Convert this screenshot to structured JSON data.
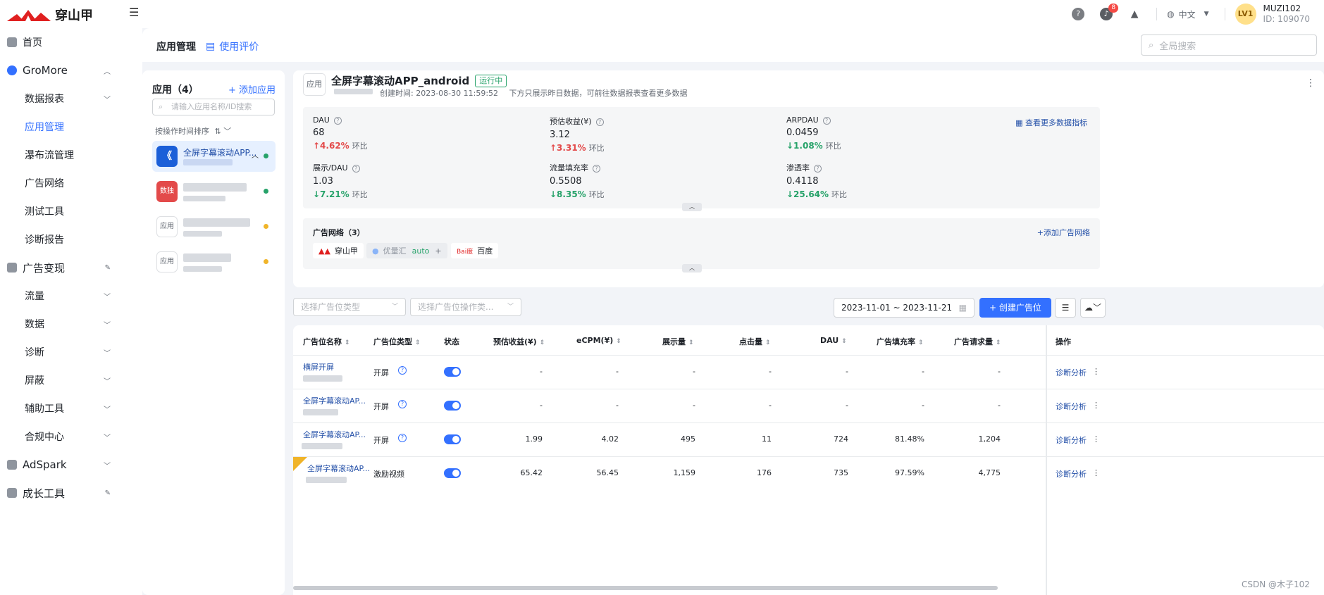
{
  "brand": {
    "name": "穿山甲",
    "accent": "#3370ff"
  },
  "topbar": {
    "notification_count": "8",
    "language": "中文",
    "level": "LV1",
    "username": "MUZI102",
    "user_id": "ID: 109070"
  },
  "sidebar": {
    "items": [
      {
        "label": "首页",
        "icon": "home-icon"
      },
      {
        "label": "GroMore",
        "icon": "gromore-icon"
      },
      {
        "label": "数据报表"
      },
      {
        "label": "应用管理"
      },
      {
        "label": "瀑布流管理"
      },
      {
        "label": "广告网络"
      },
      {
        "label": "测试工具"
      },
      {
        "label": "诊断报告"
      },
      {
        "label": "广告变现",
        "icon": "monetize-icon"
      },
      {
        "label": "流量"
      },
      {
        "label": "数据"
      },
      {
        "label": "诊断"
      },
      {
        "label": "屏蔽"
      },
      {
        "label": "辅助工具"
      },
      {
        "label": "合规中心"
      },
      {
        "label": "AdSpark",
        "icon": "adspark-icon"
      },
      {
        "label": "成长工具",
        "icon": "growth-icon"
      }
    ]
  },
  "tabs": {
    "app_manage": "应用管理",
    "usage_review": "使用评价"
  },
  "search": {
    "placeholder": "全局搜索"
  },
  "applist": {
    "title": "应用（4）",
    "add_label": "添加应用",
    "search_placeholder": "请输入应用名称/ID搜索",
    "sort_label": "按操作时间排序",
    "apps": [
      {
        "name": "全屏字幕滚动APP...",
        "icon_text": "《",
        "status_color": "#26a269"
      },
      {
        "name": "",
        "icon_text": "数独",
        "status_color": "#26a269"
      },
      {
        "name": "",
        "icon_text": "应用",
        "status_color": "#f0b429"
      },
      {
        "name": "",
        "icon_text": "应用",
        "status_color": "#f0b429"
      }
    ]
  },
  "detail": {
    "icon_text": "应用",
    "title": "全屏字幕滚动APP_android",
    "status": "运行中",
    "created": "创建时间: 2023-08-30 11:59:52",
    "note": "下方只展示昨日数据，可前往数据报表查看更多数据",
    "more_metrics": "查看更多数据指标",
    "compare_label": "环比",
    "metrics": [
      {
        "label": "DAU",
        "value": "68",
        "change": "↑4.62%",
        "dir": "up"
      },
      {
        "label": "预估收益(¥)",
        "value": "3.12",
        "change": "↑3.31%",
        "dir": "up"
      },
      {
        "label": "ARPDAU",
        "value": "0.0459",
        "change": "↓1.08%",
        "dir": "down"
      },
      {
        "label": "展示/DAU",
        "value": "1.03",
        "change": "↓7.21%",
        "dir": "down"
      },
      {
        "label": "流量填充率",
        "value": "0.5508",
        "change": "↓8.35%",
        "dir": "down"
      },
      {
        "label": "渗透率",
        "value": "0.4118",
        "change": "↓25.64%",
        "dir": "down"
      }
    ],
    "adnet_title": "广告网络（3）",
    "adnet_add": "添加广告网络",
    "networks": [
      {
        "name": "穿山甲"
      },
      {
        "name": "优量汇",
        "auto": "auto",
        "plus": "+"
      },
      {
        "name": "百度"
      }
    ]
  },
  "filters": {
    "type_placeholder": "选择广告位类型",
    "op_placeholder": "选择广告位操作类...",
    "date_range": "2023-11-01 ~ 2023-11-21",
    "create_label": "创建广告位"
  },
  "table": {
    "columns": [
      "广告位名称",
      "广告位类型",
      "状态",
      "预估收益(¥)",
      "eCPM(¥)",
      "展示量",
      "点击量",
      "DAU",
      "广告填充率",
      "广告请求量",
      "操作"
    ],
    "rows": [
      {
        "name": "横屏开屏",
        "type": "开屏",
        "revenue": "-",
        "ecpm": "-",
        "impr": "-",
        "clicks": "-",
        "dau": "-",
        "fill": "-",
        "req": "-",
        "op": "诊断分析"
      },
      {
        "name": "全屏字幕滚动AP...",
        "type": "开屏",
        "revenue": "-",
        "ecpm": "-",
        "impr": "-",
        "clicks": "-",
        "dau": "-",
        "fill": "-",
        "req": "-",
        "op": "诊断分析"
      },
      {
        "name": "全屏字幕滚动AP...",
        "type": "开屏",
        "revenue": "1.99",
        "ecpm": "4.02",
        "impr": "495",
        "clicks": "11",
        "dau": "724",
        "fill": "81.48%",
        "req": "1,204",
        "op": "诊断分析"
      },
      {
        "name": "全屏字幕滚动AP...",
        "type": "激励视频",
        "revenue": "65.42",
        "ecpm": "56.45",
        "impr": "1,159",
        "clicks": "176",
        "dau": "735",
        "fill": "97.59%",
        "req": "4,775",
        "op": "诊断分析"
      }
    ]
  },
  "watermark": "CSDN @木子102"
}
